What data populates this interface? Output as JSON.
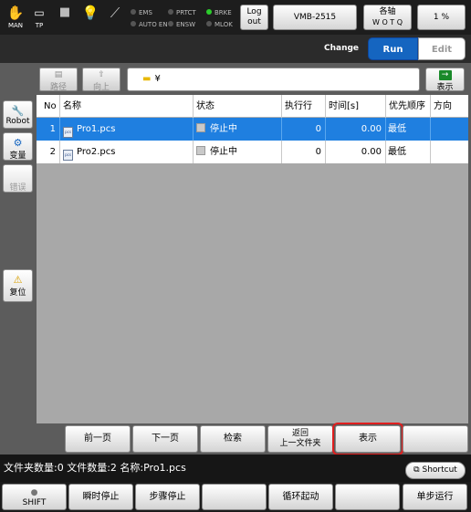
{
  "topbar": {
    "man_label": "MAN",
    "tp_label": "TP",
    "indicators": [
      {
        "label": "EMS",
        "on": false
      },
      {
        "label": "AUTO EN",
        "on": false
      },
      {
        "label": "PRTCT",
        "on": false
      },
      {
        "label": "ENSW",
        "on": false
      },
      {
        "label": "BRKE",
        "on": true
      },
      {
        "label": "MLOK",
        "on": false
      }
    ],
    "logout_label_1": "Log",
    "logout_label_2": "out",
    "robot_model": "VMB-2515",
    "axis_label_1": "各轴",
    "axis_label_2": "W O T Q",
    "speed_value": "1 %"
  },
  "changebar": {
    "change_label": "Change",
    "run_label": "Run",
    "edit_label": "Edit"
  },
  "sidebar": {
    "robot_label": "Robot",
    "variable_label": "变量",
    "error_label": "错误",
    "reset_label": "复位"
  },
  "pathbar": {
    "path_button": "路径",
    "up_button": "向上",
    "path_value": "¥",
    "display_label": "表示"
  },
  "table": {
    "columns": [
      "No",
      "名称",
      "状态",
      "执行行",
      "时间[s]",
      "优先顺序",
      "方向"
    ],
    "rows": [
      {
        "no": "1",
        "name": "Pro1.pcs",
        "status": "停止中",
        "line": "0",
        "time": "0.00",
        "priority": "最低",
        "direction": "",
        "selected": true
      },
      {
        "no": "2",
        "name": "Pro2.pcs",
        "status": "停止中",
        "line": "0",
        "time": "0.00",
        "priority": "最低",
        "direction": "",
        "selected": false
      }
    ]
  },
  "pagebuttons": {
    "prev_page": "前一页",
    "next_page": "下一页",
    "search": "检索",
    "back_line1": "返回",
    "back_line2": "上一文件夹",
    "display": "表示",
    "blank": ""
  },
  "status": {
    "text": "文件夹数量:0  文件数量:2  名称:Pro1.pcs",
    "shortcut": "Shortcut"
  },
  "funcbuttons": {
    "shift": "SHIFT",
    "instant_stop": "瞬时停止",
    "step_stop": "步骤停止",
    "blank1": "",
    "cycle_start": "循环起动",
    "blank2": "",
    "single_step": "单步运行"
  },
  "colors": {
    "selection": "#1f7fe0",
    "run_active": "#1565c0",
    "highlight_border": "#e01e1e",
    "indicator_on": "#2ccc2c"
  }
}
